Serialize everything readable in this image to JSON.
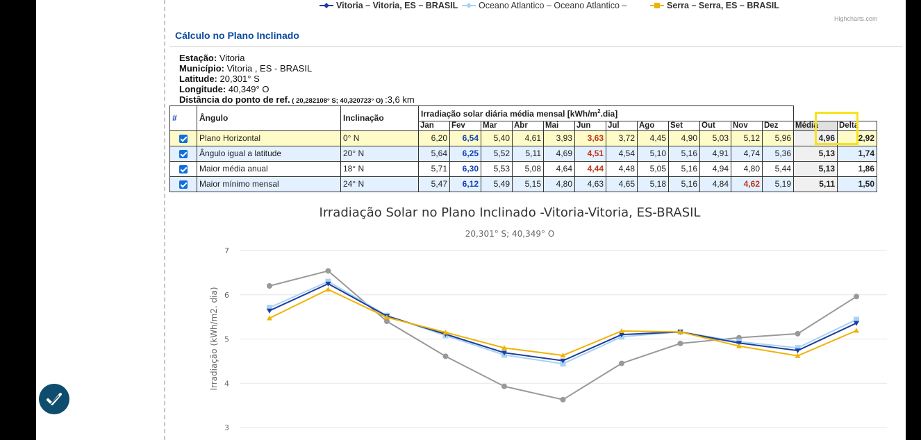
{
  "legend": [
    {
      "name": "Vitoria – Vitoria, ES – BRASIL",
      "color": "#1c3f9e",
      "marker": "diamond"
    },
    {
      "name": "Oceano Atlantico – Oceano Atlantico –",
      "color": "#a9d2f5",
      "marker": "diamond"
    },
    {
      "name": "Serra – Serra, ES – BRASIL",
      "color": "#f0b300",
      "marker": "square"
    }
  ],
  "credits": "Highcharts.com",
  "section_title": "Cálculo no Plano Inclinado",
  "info": {
    "estacao_label": "Estação:",
    "estacao": " Vitoria",
    "municipio_label": "Município:",
    "municipio": " Vitoria , ES - BRASIL",
    "latitude_label": "Latitude:",
    "latitude": " 20,301°  S",
    "longitude_label": "Longitude:",
    "longitude": " 40,349°  O",
    "dist_label": "Distância do ponto de ref.",
    "dist_coords": " ( 20,282108° S; 40,320723° O) ",
    "dist_value": ":3,6 km"
  },
  "table": {
    "h_hash": "#",
    "h_angulo": "Ângulo",
    "h_inclinacao": "Inclinação",
    "h_irr": "Irradiação solar diária média mensal [kWh/m",
    "h_irr_sup": "2",
    "h_irr_end": ".dia]",
    "months": [
      "Jan",
      "Fev",
      "Mar",
      "Abr",
      "Mai",
      "Jun",
      "Jul",
      "Ago",
      "Set",
      "Out",
      "Nov",
      "Dez",
      "Média",
      "Delta"
    ],
    "rows": [
      {
        "angulo": "Plano Horizontal",
        "inclinacao": "0° N",
        "values": [
          "6,20",
          "6,54",
          "5,40",
          "4,61",
          "3,93",
          "3,63",
          "3,72",
          "4,45",
          "4,90",
          "5,03",
          "5,12",
          "5,96"
        ],
        "max_idx": 1,
        "min_idx": 5,
        "media": "4,96",
        "delta": "2,92"
      },
      {
        "angulo": "Ângulo igual a latitude",
        "inclinacao": "20° N",
        "values": [
          "5,64",
          "6,25",
          "5,52",
          "5,11",
          "4,69",
          "4,51",
          "4,54",
          "5,10",
          "5,16",
          "4,91",
          "4,74",
          "5,36"
        ],
        "max_idx": 1,
        "min_idx": 5,
        "media": "5,13",
        "delta": "1,74"
      },
      {
        "angulo": "Maior média anual",
        "inclinacao": "18° N",
        "values": [
          "5,71",
          "6,30",
          "5,53",
          "5,08",
          "4,64",
          "4,44",
          "4,48",
          "5,05",
          "5,16",
          "4,94",
          "4,80",
          "5,44"
        ],
        "max_idx": 1,
        "min_idx": 5,
        "media": "5,13",
        "delta": "1,86"
      },
      {
        "angulo": "Maior mínimo mensal",
        "inclinacao": "24° N",
        "values": [
          "5,47",
          "6,12",
          "5,49",
          "5,15",
          "4,80",
          "4,63",
          "4,65",
          "5,18",
          "5,16",
          "4,84",
          "4,62",
          "5,19"
        ],
        "max_idx": 1,
        "min_idx": 10,
        "media": "5,11",
        "delta": "1,50"
      }
    ]
  },
  "chart_data": {
    "type": "line",
    "title": "Irradiação Solar no Plano Inclinado -Vitoria-Vitoria, ES-BRASIL",
    "subtitle": "20,301° S; 40,349° O",
    "ylabel": "Irradiação (kWh/m2. dia)",
    "ylim": [
      3,
      7
    ],
    "yticks": [
      "3",
      "4",
      "5",
      "6",
      "7"
    ],
    "series": [
      {
        "color": "#999999",
        "values": [
          6.2,
          6.54,
          5.4,
          4.61,
          3.93,
          3.63,
          4.45,
          4.9,
          5.03,
          5.12,
          5.96
        ]
      },
      {
        "color": "#a9d2f5",
        "values": [
          5.71,
          6.3,
          5.53,
          5.08,
          4.64,
          4.44,
          5.05,
          5.16,
          4.94,
          4.8,
          5.44
        ]
      },
      {
        "color": "#1c3f9e",
        "values": [
          5.64,
          6.25,
          5.52,
          5.11,
          4.69,
          4.51,
          5.1,
          5.16,
          4.91,
          4.74,
          5.36
        ]
      },
      {
        "color": "#f0b300",
        "values": [
          5.47,
          6.12,
          5.49,
          5.15,
          4.8,
          4.63,
          5.18,
          5.16,
          4.84,
          4.62,
          5.19
        ]
      }
    ]
  }
}
